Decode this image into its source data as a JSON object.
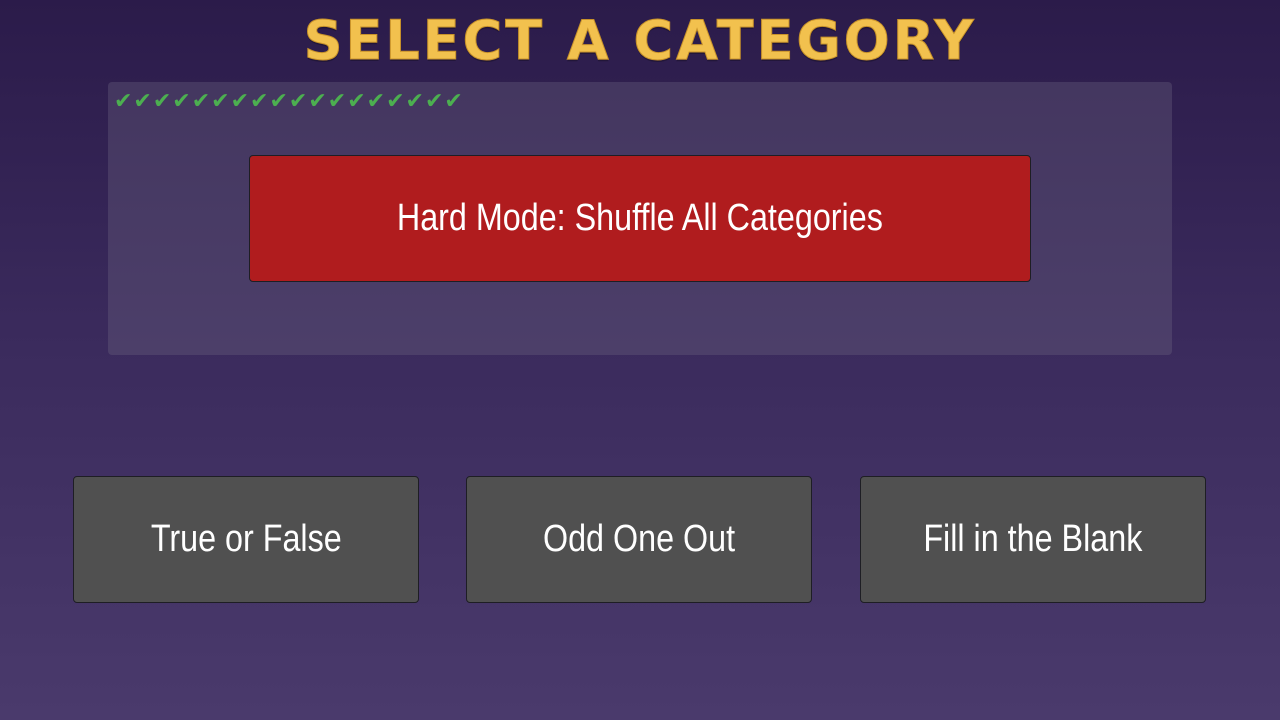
{
  "title": "SELECT A CATEGORY",
  "progress": {
    "checkmarks": "✔✔✔✔✔✔✔✔✔✔✔✔✔✔✔✔✔✔",
    "completed_count": 18,
    "check_color": "#4caf50"
  },
  "hard_mode": {
    "label": "Hard Mode: Shuffle All Categories",
    "color": "#b01c1e"
  },
  "categories": [
    {
      "label": "True or False"
    },
    {
      "label": "Odd One Out"
    },
    {
      "label": "Fill in the Blank"
    }
  ],
  "colors": {
    "title": "#f2c14e",
    "category_button": "#505050",
    "background_top": "#2b1b4a",
    "background_bottom": "#4a3a6c"
  }
}
